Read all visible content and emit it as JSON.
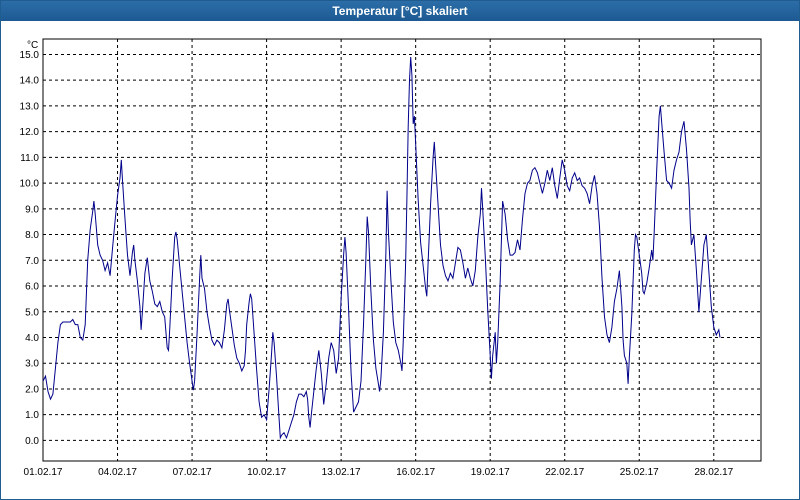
{
  "window": {
    "title": "Temperatur [°C] skaliert"
  },
  "colors": {
    "titlebar": "#1f5d91",
    "line": "#00008b",
    "grid": "#000000"
  },
  "chart_data": {
    "type": "line",
    "title": "Temperatur [°C] skaliert",
    "ylabel": "°C",
    "xlabel": "",
    "ylim": [
      -0.8,
      15.6
    ],
    "x_range_days": [
      0,
      28.9
    ],
    "grid": "dashed",
    "y_ticks": [
      "0.0",
      "1.0",
      "2.0",
      "3.0",
      "4.0",
      "5.0",
      "6.0",
      "7.0",
      "8.0",
      "9.0",
      "10.0",
      "11.0",
      "12.0",
      "13.0",
      "14.0",
      "15.0"
    ],
    "x_ticks": [
      "01.02.17",
      "04.02.17",
      "07.02.17",
      "10.02.17",
      "13.02.17",
      "16.02.17",
      "19.02.17",
      "22.02.17",
      "25.02.17",
      "28.02.17"
    ],
    "series": [
      {
        "points": [
          [
            0.0,
            2.3
          ],
          [
            0.1,
            2.5
          ],
          [
            0.2,
            1.9
          ],
          [
            0.3,
            1.6
          ],
          [
            0.4,
            1.8
          ],
          [
            0.5,
            2.8
          ],
          [
            0.6,
            3.8
          ],
          [
            0.7,
            4.5
          ],
          [
            0.8,
            4.6
          ],
          [
            0.9,
            4.6
          ],
          [
            1.0,
            4.6
          ],
          [
            1.1,
            4.6
          ],
          [
            1.2,
            4.7
          ],
          [
            1.3,
            4.5
          ],
          [
            1.4,
            4.5
          ],
          [
            1.5,
            4.0
          ],
          [
            1.6,
            3.9
          ],
          [
            1.7,
            4.5
          ],
          [
            1.8,
            7.0
          ],
          [
            1.9,
            8.2
          ],
          [
            2.0,
            8.9
          ],
          [
            2.05,
            9.3
          ],
          [
            2.1,
            8.8
          ],
          [
            2.2,
            7.6
          ],
          [
            2.3,
            7.2
          ],
          [
            2.4,
            7.0
          ],
          [
            2.5,
            6.6
          ],
          [
            2.6,
            6.9
          ],
          [
            2.7,
            6.4
          ],
          [
            2.8,
            7.5
          ],
          [
            2.9,
            8.5
          ],
          [
            3.0,
            9.5
          ],
          [
            3.1,
            10.2
          ],
          [
            3.15,
            10.9
          ],
          [
            3.2,
            10.1
          ],
          [
            3.3,
            8.6
          ],
          [
            3.4,
            7.2
          ],
          [
            3.5,
            6.4
          ],
          [
            3.6,
            7.3
          ],
          [
            3.65,
            7.6
          ],
          [
            3.7,
            7.0
          ],
          [
            3.8,
            6.2
          ],
          [
            3.9,
            5.2
          ],
          [
            3.95,
            4.3
          ],
          [
            4.0,
            5.0
          ],
          [
            4.1,
            6.5
          ],
          [
            4.2,
            7.1
          ],
          [
            4.3,
            6.2
          ],
          [
            4.4,
            5.8
          ],
          [
            4.5,
            5.3
          ],
          [
            4.6,
            5.2
          ],
          [
            4.7,
            5.4
          ],
          [
            4.8,
            5.0
          ],
          [
            4.9,
            4.8
          ],
          [
            5.0,
            3.6
          ],
          [
            5.05,
            3.5
          ],
          [
            5.1,
            4.3
          ],
          [
            5.2,
            6.3
          ],
          [
            5.3,
            7.9
          ],
          [
            5.35,
            8.1
          ],
          [
            5.4,
            7.8
          ],
          [
            5.5,
            6.8
          ],
          [
            5.6,
            5.8
          ],
          [
            5.7,
            4.8
          ],
          [
            5.8,
            3.8
          ],
          [
            5.9,
            3.0
          ],
          [
            6.0,
            2.3
          ],
          [
            6.05,
            1.95
          ],
          [
            6.1,
            2.3
          ],
          [
            6.2,
            4.1
          ],
          [
            6.3,
            6.2
          ],
          [
            6.35,
            7.2
          ],
          [
            6.4,
            6.3
          ],
          [
            6.5,
            5.9
          ],
          [
            6.6,
            5.0
          ],
          [
            6.7,
            4.4
          ],
          [
            6.8,
            3.9
          ],
          [
            6.9,
            3.7
          ],
          [
            7.0,
            3.9
          ],
          [
            7.1,
            3.8
          ],
          [
            7.2,
            3.6
          ],
          [
            7.3,
            4.3
          ],
          [
            7.4,
            5.3
          ],
          [
            7.45,
            5.5
          ],
          [
            7.5,
            5.1
          ],
          [
            7.6,
            4.4
          ],
          [
            7.7,
            3.7
          ],
          [
            7.8,
            3.2
          ],
          [
            7.9,
            3.0
          ],
          [
            8.0,
            2.7
          ],
          [
            8.1,
            2.9
          ],
          [
            8.15,
            3.5
          ],
          [
            8.2,
            4.5
          ],
          [
            8.3,
            5.4
          ],
          [
            8.35,
            5.7
          ],
          [
            8.4,
            5.5
          ],
          [
            8.5,
            4.1
          ],
          [
            8.6,
            2.7
          ],
          [
            8.7,
            1.5
          ],
          [
            8.8,
            0.9
          ],
          [
            8.9,
            1.0
          ],
          [
            9.0,
            0.8
          ],
          [
            9.1,
            2.0
          ],
          [
            9.2,
            3.4
          ],
          [
            9.25,
            4.2
          ],
          [
            9.3,
            3.8
          ],
          [
            9.4,
            2.5
          ],
          [
            9.5,
            0.9
          ],
          [
            9.55,
            0.1
          ],
          [
            9.6,
            0.2
          ],
          [
            9.7,
            0.3
          ],
          [
            9.8,
            0.1
          ],
          [
            9.9,
            0.4
          ],
          [
            10.0,
            0.7
          ],
          [
            10.1,
            1.0
          ],
          [
            10.2,
            1.5
          ],
          [
            10.3,
            1.8
          ],
          [
            10.4,
            1.8
          ],
          [
            10.5,
            1.7
          ],
          [
            10.6,
            1.9
          ],
          [
            10.65,
            1.6
          ],
          [
            10.7,
            0.9
          ],
          [
            10.75,
            0.5
          ],
          [
            10.8,
            1.0
          ],
          [
            10.9,
            1.9
          ],
          [
            11.0,
            2.8
          ],
          [
            11.1,
            3.5
          ],
          [
            11.2,
            2.6
          ],
          [
            11.3,
            1.4
          ],
          [
            11.4,
            2.2
          ],
          [
            11.5,
            3.2
          ],
          [
            11.6,
            3.8
          ],
          [
            11.7,
            3.5
          ],
          [
            11.8,
            2.6
          ],
          [
            11.9,
            3.2
          ],
          [
            12.0,
            5.5
          ],
          [
            12.1,
            7.2
          ],
          [
            12.15,
            7.9
          ],
          [
            12.2,
            7.3
          ],
          [
            12.3,
            5.1
          ],
          [
            12.4,
            2.6
          ],
          [
            12.5,
            1.1
          ],
          [
            12.6,
            1.3
          ],
          [
            12.7,
            1.5
          ],
          [
            12.8,
            2.3
          ],
          [
            12.9,
            4.5
          ],
          [
            13.0,
            7.2
          ],
          [
            13.05,
            8.7
          ],
          [
            13.1,
            8.1
          ],
          [
            13.2,
            5.8
          ],
          [
            13.3,
            3.9
          ],
          [
            13.4,
            2.8
          ],
          [
            13.5,
            2.2
          ],
          [
            13.55,
            1.9
          ],
          [
            13.6,
            2.4
          ],
          [
            13.7,
            4.2
          ],
          [
            13.8,
            7.3
          ],
          [
            13.85,
            9.7
          ],
          [
            13.9,
            8.2
          ],
          [
            14.0,
            6.3
          ],
          [
            14.1,
            4.6
          ],
          [
            14.2,
            3.8
          ],
          [
            14.3,
            3.5
          ],
          [
            14.4,
            3.0
          ],
          [
            14.45,
            2.7
          ],
          [
            14.5,
            3.8
          ],
          [
            14.6,
            7.0
          ],
          [
            14.65,
            9.6
          ],
          [
            14.7,
            12.2
          ],
          [
            14.75,
            14.0
          ],
          [
            14.8,
            14.9
          ],
          [
            14.85,
            14.2
          ],
          [
            14.9,
            12.3
          ],
          [
            14.95,
            12.6
          ],
          [
            15.0,
            11.5
          ],
          [
            15.1,
            9.4
          ],
          [
            15.2,
            7.7
          ],
          [
            15.3,
            6.8
          ],
          [
            15.4,
            5.9
          ],
          [
            15.45,
            5.6
          ],
          [
            15.5,
            6.9
          ],
          [
            15.6,
            9.2
          ],
          [
            15.7,
            11.0
          ],
          [
            15.75,
            11.6
          ],
          [
            15.8,
            10.8
          ],
          [
            15.9,
            9.2
          ],
          [
            16.0,
            7.6
          ],
          [
            16.1,
            6.8
          ],
          [
            16.2,
            6.4
          ],
          [
            16.3,
            6.2
          ],
          [
            16.4,
            6.5
          ],
          [
            16.5,
            6.3
          ],
          [
            16.6,
            6.9
          ],
          [
            16.7,
            7.5
          ],
          [
            16.8,
            7.4
          ],
          [
            16.9,
            6.9
          ],
          [
            17.0,
            6.3
          ],
          [
            17.1,
            6.7
          ],
          [
            17.2,
            6.3
          ],
          [
            17.3,
            6.0
          ],
          [
            17.4,
            6.6
          ],
          [
            17.5,
            7.9
          ],
          [
            17.6,
            8.8
          ],
          [
            17.65,
            9.8
          ],
          [
            17.7,
            9.0
          ],
          [
            17.8,
            7.2
          ],
          [
            17.9,
            5.1
          ],
          [
            18.0,
            3.3
          ],
          [
            18.05,
            2.4
          ],
          [
            18.1,
            3.3
          ],
          [
            18.2,
            4.2
          ],
          [
            18.25,
            3.0
          ],
          [
            18.3,
            3.8
          ],
          [
            18.4,
            6.1
          ],
          [
            18.5,
            9.3
          ],
          [
            18.6,
            8.8
          ],
          [
            18.7,
            7.8
          ],
          [
            18.8,
            7.2
          ],
          [
            18.9,
            7.2
          ],
          [
            19.0,
            7.3
          ],
          [
            19.1,
            7.8
          ],
          [
            19.2,
            7.4
          ],
          [
            19.3,
            8.6
          ],
          [
            19.4,
            9.6
          ],
          [
            19.5,
            10.0
          ],
          [
            19.6,
            10.1
          ],
          [
            19.7,
            10.5
          ],
          [
            19.8,
            10.6
          ],
          [
            19.9,
            10.4
          ],
          [
            20.0,
            10.0
          ],
          [
            20.1,
            9.6
          ],
          [
            20.2,
            10.0
          ],
          [
            20.3,
            10.5
          ],
          [
            20.4,
            10.1
          ],
          [
            20.5,
            10.6
          ],
          [
            20.6,
            9.9
          ],
          [
            20.7,
            9.4
          ],
          [
            20.8,
            10.2
          ],
          [
            20.9,
            10.9
          ],
          [
            21.0,
            10.5
          ],
          [
            21.1,
            9.9
          ],
          [
            21.2,
            9.7
          ],
          [
            21.3,
            10.2
          ],
          [
            21.4,
            10.4
          ],
          [
            21.5,
            10.1
          ],
          [
            21.6,
            10.2
          ],
          [
            21.7,
            9.9
          ],
          [
            21.8,
            9.8
          ],
          [
            21.9,
            9.6
          ],
          [
            22.0,
            9.2
          ],
          [
            22.1,
            9.9
          ],
          [
            22.2,
            10.3
          ],
          [
            22.3,
            9.6
          ],
          [
            22.4,
            8.3
          ],
          [
            22.5,
            6.3
          ],
          [
            22.6,
            4.8
          ],
          [
            22.7,
            4.1
          ],
          [
            22.8,
            3.8
          ],
          [
            22.9,
            4.4
          ],
          [
            23.0,
            5.4
          ],
          [
            23.1,
            5.9
          ],
          [
            23.2,
            6.6
          ],
          [
            23.3,
            5.2
          ],
          [
            23.35,
            3.9
          ],
          [
            23.4,
            3.3
          ],
          [
            23.5,
            3.0
          ],
          [
            23.55,
            2.2
          ],
          [
            23.6,
            3.2
          ],
          [
            23.7,
            4.9
          ],
          [
            23.8,
            7.4
          ],
          [
            23.85,
            8.0
          ],
          [
            23.9,
            7.9
          ],
          [
            24.0,
            7.2
          ],
          [
            24.1,
            6.5
          ],
          [
            24.15,
            5.8
          ],
          [
            24.2,
            5.7
          ],
          [
            24.3,
            6.1
          ],
          [
            24.4,
            6.7
          ],
          [
            24.5,
            7.4
          ],
          [
            24.55,
            7.0
          ],
          [
            24.6,
            8.1
          ],
          [
            24.7,
            10.5
          ],
          [
            24.8,
            12.6
          ],
          [
            24.85,
            13.0
          ],
          [
            24.9,
            12.4
          ],
          [
            25.0,
            11.2
          ],
          [
            25.1,
            10.1
          ],
          [
            25.2,
            10.0
          ],
          [
            25.3,
            9.8
          ],
          [
            25.4,
            10.5
          ],
          [
            25.5,
            10.9
          ],
          [
            25.6,
            11.2
          ],
          [
            25.7,
            12.0
          ],
          [
            25.8,
            12.4
          ],
          [
            25.9,
            11.3
          ],
          [
            26.0,
            9.8
          ],
          [
            26.05,
            8.5
          ],
          [
            26.1,
            7.6
          ],
          [
            26.2,
            8.0
          ],
          [
            26.3,
            6.6
          ],
          [
            26.4,
            5.0
          ],
          [
            26.5,
            6.3
          ],
          [
            26.6,
            7.6
          ],
          [
            26.7,
            8.0
          ],
          [
            26.8,
            6.6
          ],
          [
            26.9,
            5.2
          ],
          [
            27.0,
            4.4
          ],
          [
            27.1,
            4.1
          ],
          [
            27.2,
            4.3
          ],
          [
            27.25,
            4.0
          ]
        ]
      }
    ]
  }
}
